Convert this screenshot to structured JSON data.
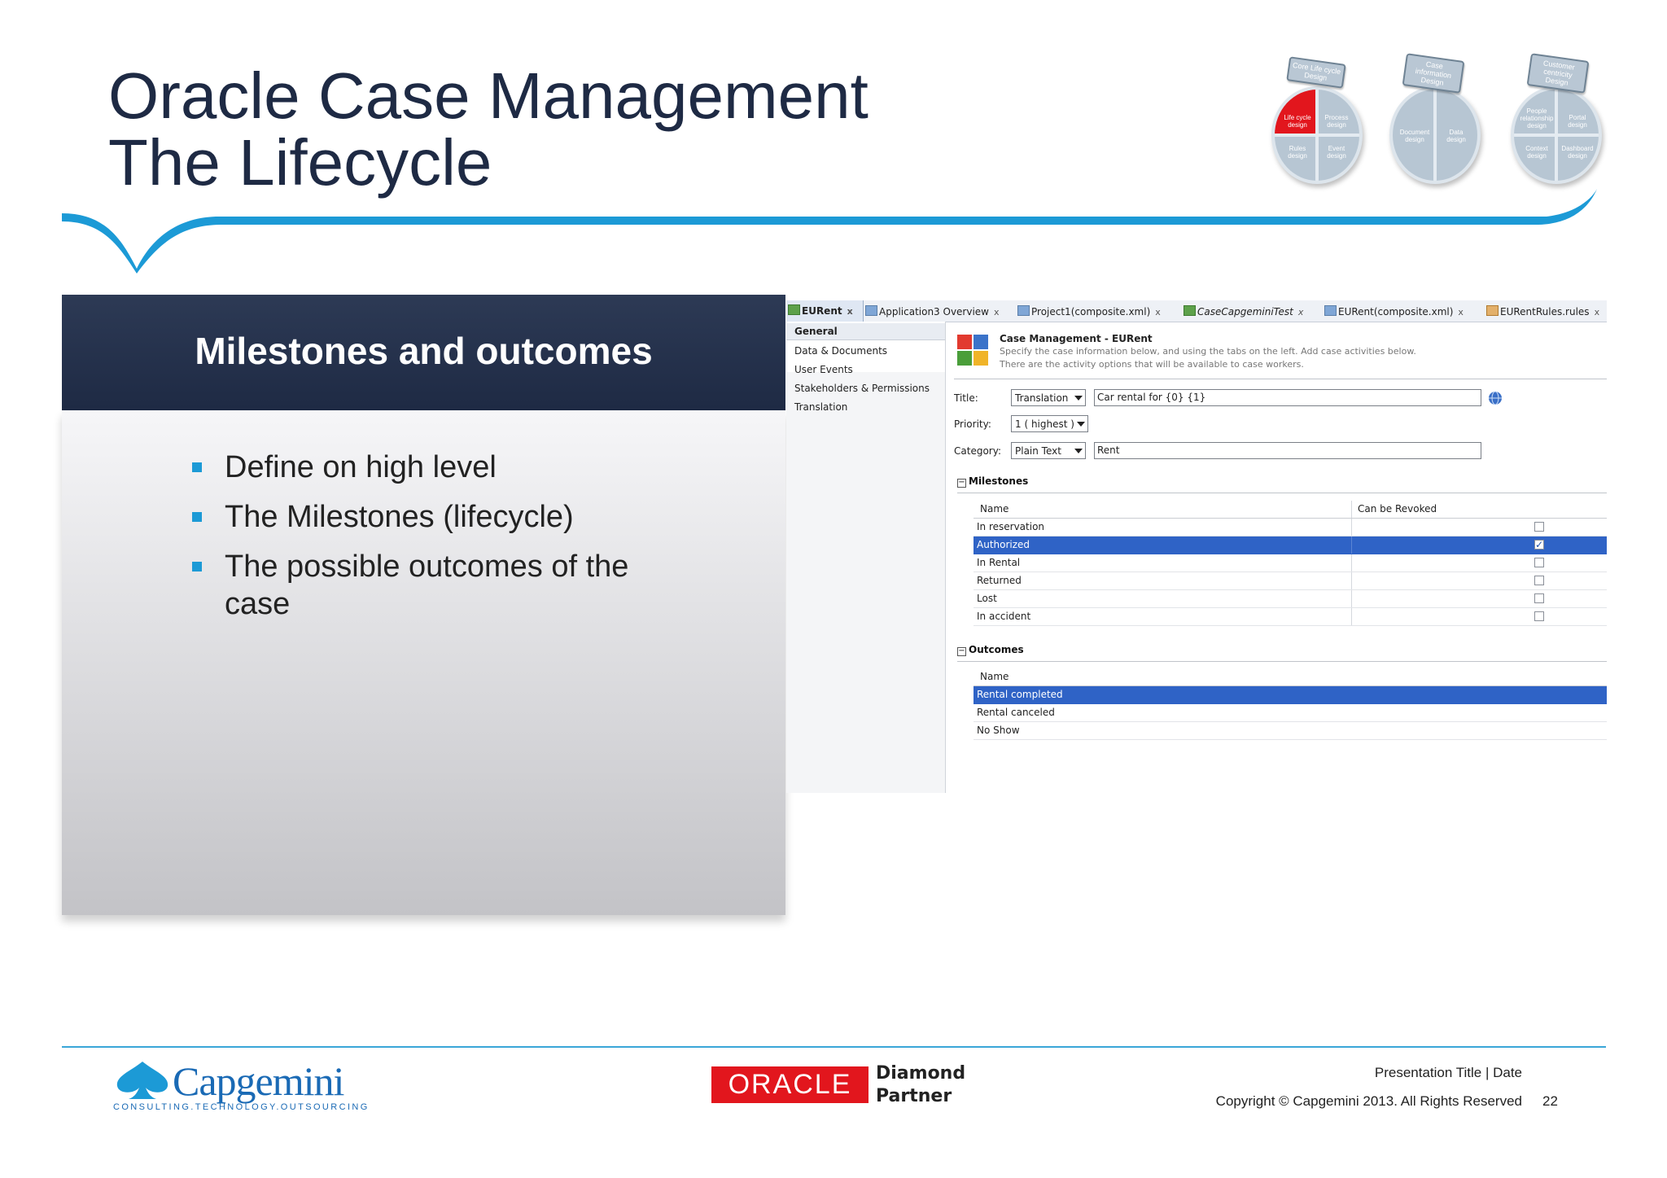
{
  "slide": {
    "title_line1": "Oracle Case Management",
    "title_line2": "The Lifecycle",
    "panel_title": "Milestones and outcomes",
    "bullets": [
      "Define on high level",
      "The Milestones (lifecycle)",
      "The possible outcomes of the",
      "case"
    ]
  },
  "wheels": [
    {
      "tag": "Core Life cycle Design",
      "quadrants": [
        "Life cycle design",
        "Process design",
        "Rules design",
        "Event design"
      ],
      "highlight_color": "#e2161d"
    },
    {
      "tag": "Case information Design",
      "quadrants": [
        "Document design",
        "Data design"
      ]
    },
    {
      "tag": "Customer centricity Design",
      "quadrants": [
        "People relationship design",
        "Portal design",
        "Context design",
        "Dashboard design"
      ]
    }
  ],
  "editor": {
    "tabs": [
      {
        "label": "EURent",
        "active": true
      },
      {
        "label": "Application3 Overview"
      },
      {
        "label": "Project1(composite.xml)"
      },
      {
        "label": "CaseCapgeminiTest"
      },
      {
        "label": "EURent(composite.xml)"
      },
      {
        "label": "EURentRules.rules"
      }
    ],
    "tab_close": "x",
    "nav": [
      "General",
      "Data & Documents",
      "User Events",
      "Stakeholders & Permissions",
      "Translation"
    ],
    "header_title": "Case Management - EURent",
    "header_desc1": "Specify the case information below, and using the tabs on the left. Add case activities below.",
    "header_desc2": "There are the activity options that will be available to case workers.",
    "title_label": "Title:",
    "title_select": "Translation",
    "title_value": "Car rental for {0} {1}",
    "priority_label": "Priority:",
    "priority_value": "1 ( highest )",
    "category_label": "Category:",
    "category_select": "Plain Text",
    "category_value": "Rent",
    "milestones_header": "Milestones",
    "col_name": "Name",
    "col_revoked": "Can be Revoked",
    "milestones": [
      {
        "name": "In reservation",
        "revoked": false,
        "selected": false
      },
      {
        "name": "Authorized",
        "revoked": true,
        "selected": true
      },
      {
        "name": "In Rental",
        "revoked": false,
        "selected": false
      },
      {
        "name": "Returned",
        "revoked": false,
        "selected": false
      },
      {
        "name": "Lost",
        "revoked": false,
        "selected": false
      },
      {
        "name": "In accident",
        "revoked": false,
        "selected": false
      }
    ],
    "outcomes_header": "Outcomes",
    "outcomes": [
      {
        "name": "Rental completed",
        "selected": true
      },
      {
        "name": "Rental canceled",
        "selected": false
      },
      {
        "name": "No Show",
        "selected": false
      }
    ]
  },
  "footer": {
    "capgemini": "Capgemini",
    "capgemini_tagline": "CONSULTING.TECHNOLOGY.OUTSOURCING",
    "oracle": "ORACLE",
    "partner_line1": "Diamond",
    "partner_line2": "Partner",
    "presentation_title": "Presentation Title | Date",
    "copyright": "Copyright © Capgemini 2013. All Rights Reserved",
    "page_number": "22"
  },
  "colors": {
    "title": "#1e2a44",
    "accent_blue": "#1c9ad6",
    "panel_head": "#1e2a44",
    "selection": "#2f63c6",
    "oracle_red": "#e2161d",
    "capgemini_blue": "#1a6ab5"
  }
}
